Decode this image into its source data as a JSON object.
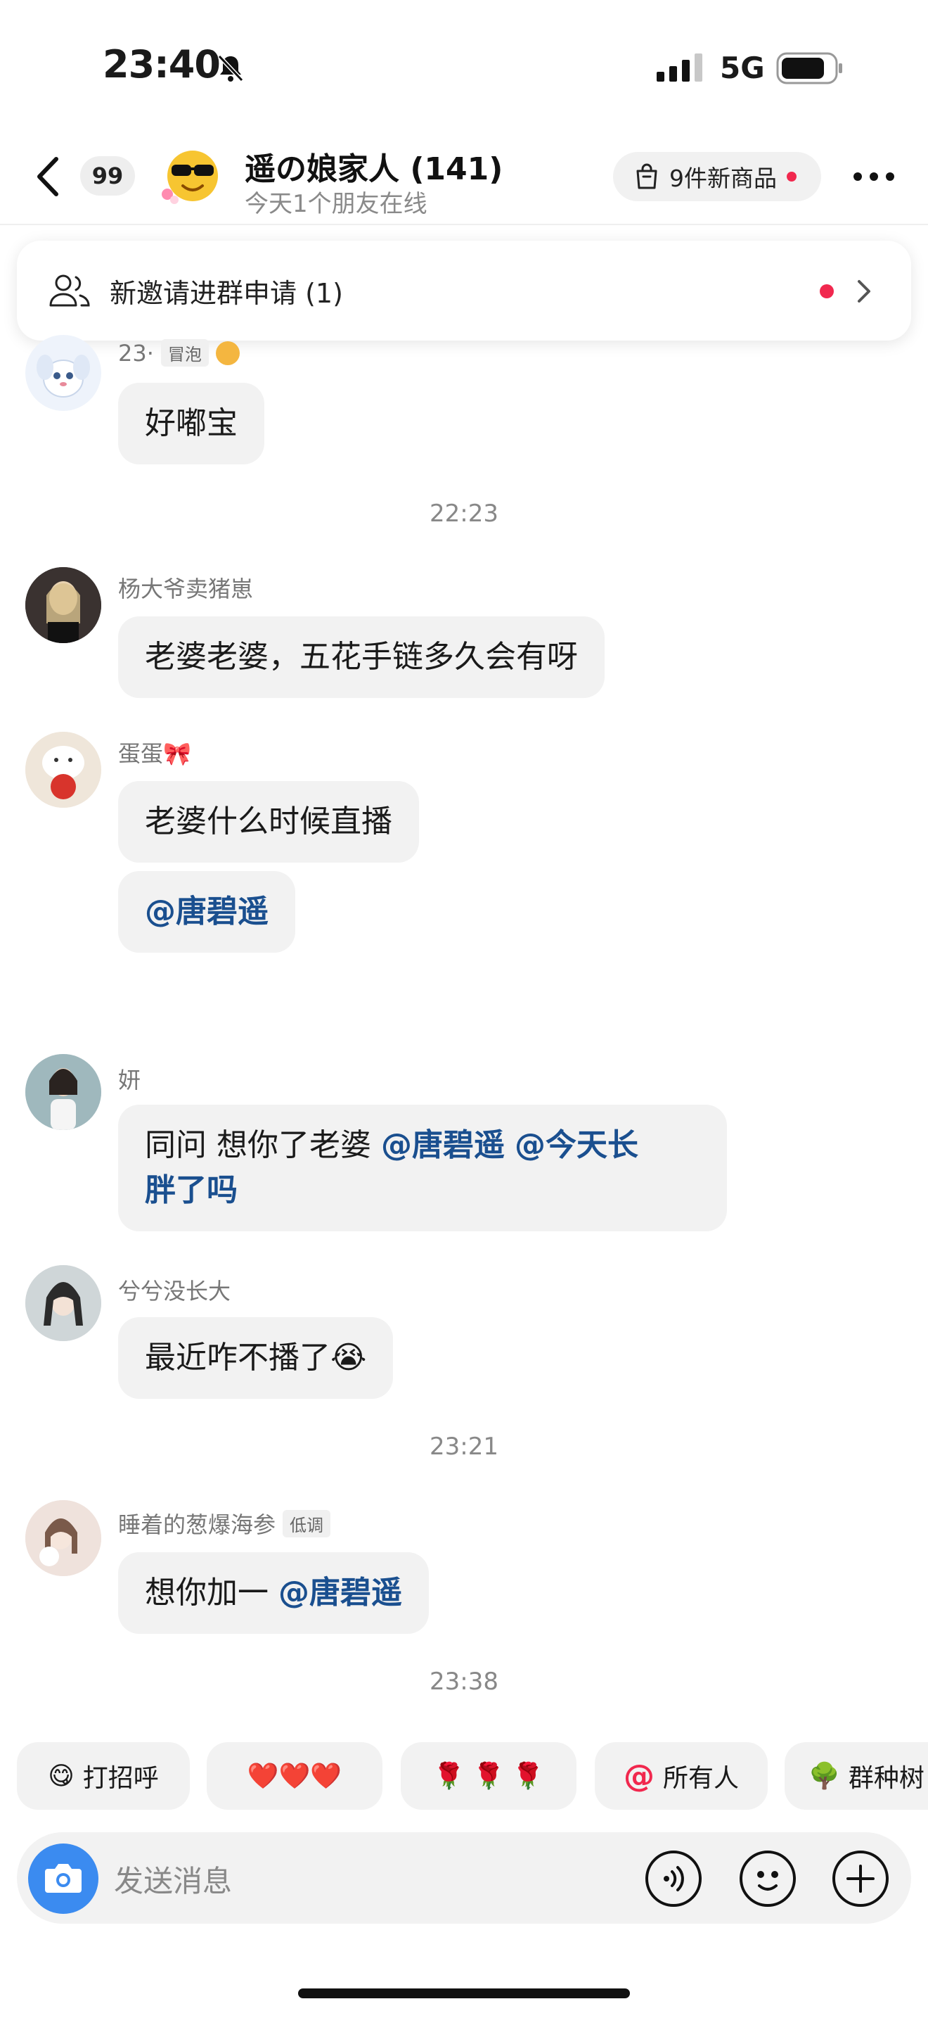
{
  "status_bar": {
    "time": "23:40",
    "network": "5G"
  },
  "header": {
    "unread_count": "99",
    "title": "遥の娘家人 (141)",
    "subtitle": "今天1个朋友在线",
    "goods_label": "9件新商品"
  },
  "invite_banner": {
    "text": "新邀请进群申请 (1)"
  },
  "messages": [
    {
      "nick": "23·",
      "tag": "冒泡",
      "text": "好嘟宝"
    },
    {
      "nick": "杨大爷卖猪崽",
      "text": "老婆老婆，五花手链多久会有呀"
    },
    {
      "nick": "蛋蛋🎀",
      "text": "老婆什么时候直播",
      "text2": "@唐碧遥"
    },
    {
      "nick": "妍",
      "text_a": "同问 想你了老婆",
      "mention_a": "@唐碧遥",
      "mention_b": "@今天长",
      "mention_c": "胖了吗"
    },
    {
      "nick": "兮兮没长大",
      "text": "最近咋不播了😭"
    },
    {
      "nick": "睡着的葱爆海参",
      "tag": "低调",
      "text": "想你加一",
      "mention": "@唐碧遥"
    }
  ],
  "timestamps": [
    "22:23",
    "23:21",
    "23:38"
  ],
  "quick_replies": [
    {
      "emoji": "😋",
      "label": "打招呼"
    },
    {
      "emoji": "❤️❤️❤️",
      "label": ""
    },
    {
      "emoji": "🌹 🌹 🌹",
      "label": ""
    },
    {
      "emoji": "@",
      "label": "所有人"
    },
    {
      "emoji": "🌳",
      "label": "群种树"
    }
  ],
  "input": {
    "placeholder": "发送消息"
  },
  "colors": {
    "accent_red": "#f1284e",
    "mention_blue": "#1a4f8f",
    "camera_blue": "#3b8bf0"
  }
}
